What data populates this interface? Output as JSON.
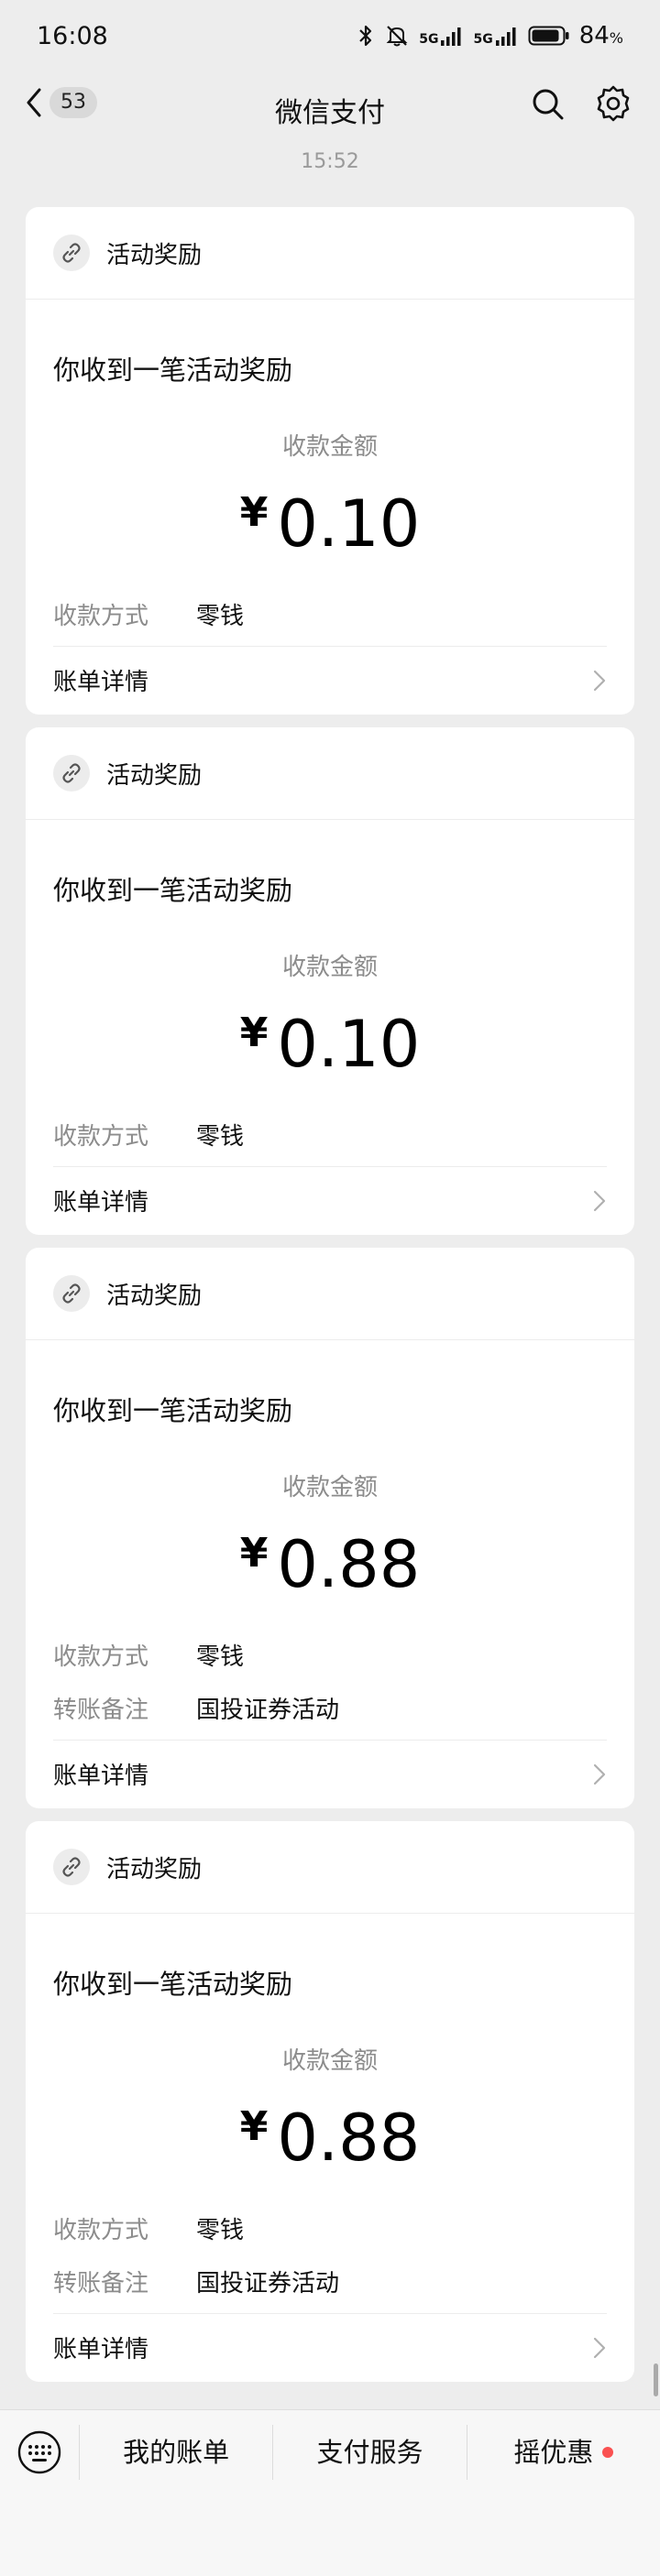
{
  "status_bar": {
    "time": "16:08",
    "net1": "5G",
    "net2": "5G",
    "battery": "84",
    "battery_unit": "%"
  },
  "nav": {
    "unread_count": "53",
    "title": "微信支付"
  },
  "timestamp": "15:52",
  "cards": [
    {
      "header": "活动奖励",
      "message": "你收到一笔活动奖励",
      "amount_label": "收款金额",
      "currency": "¥",
      "amount": "0.10",
      "method_label": "收款方式",
      "method_value": "零钱",
      "footer": "账单详情"
    },
    {
      "header": "活动奖励",
      "message": "你收到一笔活动奖励",
      "amount_label": "收款金额",
      "currency": "¥",
      "amount": "0.10",
      "method_label": "收款方式",
      "method_value": "零钱",
      "footer": "账单详情"
    },
    {
      "header": "活动奖励",
      "message": "你收到一笔活动奖励",
      "amount_label": "收款金额",
      "currency": "¥",
      "amount": "0.88",
      "method_label": "收款方式",
      "method_value": "零钱",
      "note_label": "转账备注",
      "note_value": "国投证券活动",
      "footer": "账单详情"
    },
    {
      "header": "活动奖励",
      "message": "你收到一笔活动奖励",
      "amount_label": "收款金额",
      "currency": "¥",
      "amount": "0.88",
      "method_label": "收款方式",
      "method_value": "零钱",
      "note_label": "转账备注",
      "note_value": "国投证券活动",
      "footer": "账单详情"
    }
  ],
  "bottom_menu": {
    "items": [
      "我的账单",
      "支付服务",
      "摇优惠"
    ]
  }
}
